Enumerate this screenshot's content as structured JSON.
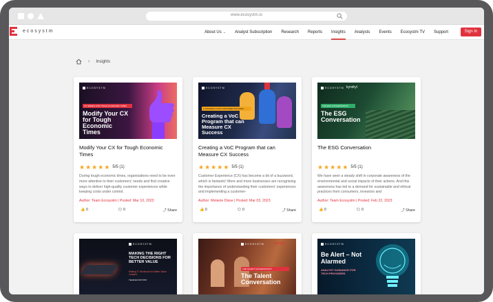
{
  "browser": {
    "url": "www.ecosystm.io"
  },
  "site": {
    "brand": "ecosystm",
    "nav": [
      {
        "label": "About Us",
        "dropdown": true,
        "active": false
      },
      {
        "label": "Analyst Subscription",
        "active": false
      },
      {
        "label": "Research",
        "active": false
      },
      {
        "label": "Reports",
        "active": false
      },
      {
        "label": "Insights",
        "active": true
      },
      {
        "label": "Analysts",
        "active": false
      },
      {
        "label": "Events",
        "active": false
      },
      {
        "label": "Ecosystm TV",
        "active": false
      },
      {
        "label": "Support",
        "active": false
      }
    ],
    "signin_label": "Sign In",
    "accent": "#e0323e"
  },
  "breadcrumb": {
    "current": "Insights"
  },
  "cards": [
    {
      "image": {
        "logo": "ECOSYSTM",
        "banner": "CX SERIES FOR TOUGH ECONOMIC TIMES",
        "title": "Modify Your CX for Tough Economic Times"
      },
      "title": "Modify Your CX for Tough Economic Times",
      "rating": "5/5 (1)",
      "desc": "During tough economic times, organisations need to be even more attentive to their customers' needs and find creative ways to deliver high-quality customer experiences while keeping costs under control.",
      "meta": "Author: Team Ecosystm | Posted: Mar 10, 2023",
      "likes": "0",
      "comments": "0",
      "share": "Share"
    },
    {
      "image": {
        "logo": "ECOSYSTM",
        "banner": "A STRATEGY FOR CUSTOMER SUCCESS",
        "title": "Creating a VoC Program that can Measure CX Success"
      },
      "title": "Creating a VoC Program that can Measure CX Success",
      "rating": "5/5 (1)",
      "desc": "Customer Experience (CX) has become a bit of a buzzword, which is fantastic! More and more businesses are recognising the importance of understanding their customers' experiences and implementing a customer-",
      "meta": "Author: Melanie Disse | Posted: Mar 03, 2023",
      "likes": "0",
      "comments": "0",
      "share": "Share"
    },
    {
      "image": {
        "logo": "ECOSYSTM",
        "partner": "kyndryl",
        "banner": "THE ESG CONVERSATION",
        "title": "The ESG Conversation"
      },
      "title": "The ESG Conversation",
      "rating": "5/5 (1)",
      "desc": "We have seen a steady shift in corporate awareness of the environmental and social impacts of their actions. And this awareness has led to a demand for sustainable and ethical practices from consumers, investors and",
      "meta": "Author: Team Ecosystm | Posted: Feb 22, 2023",
      "likes": "0",
      "comments": "0",
      "share": "Share"
    },
    {
      "image": {
        "logo": "ECOSYSTM",
        "title": "MAKING THE RIGHT TECH DECISIONS FOR BETTER VALUE",
        "sub": "Making IT Decisions for Better Value Leaders",
        "author": "TEAM ECOSYSTM"
      }
    },
    {
      "image": {
        "logo": "ECOSYSTM",
        "partner": "kyndryl",
        "banner": "THE TALENT CONVERSATION",
        "title": "The Talent Conversation"
      }
    },
    {
      "image": {
        "logo": "ECOSYSTM",
        "title": "Be Alert – Not Alarmed",
        "sub": "ANALYST GUIDANCE FOR TECH PROVIDERS"
      }
    }
  ]
}
